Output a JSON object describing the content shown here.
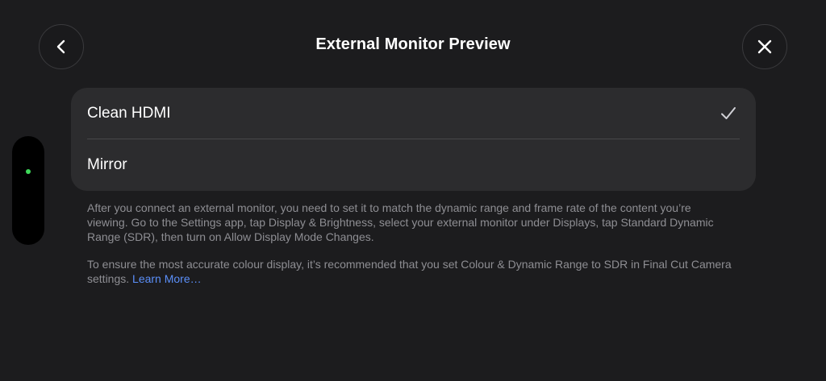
{
  "header": {
    "title": "External Monitor Preview",
    "back_icon": "chevron-left-icon",
    "close_icon": "close-icon"
  },
  "side_indicator": {
    "dot_color": "#3fd95a"
  },
  "options": [
    {
      "label": "Clean HDMI",
      "selected": true
    },
    {
      "label": "Mirror",
      "selected": false
    }
  ],
  "info": {
    "paragraph1": "After you connect an external monitor, you need to set it to match the dynamic range and frame rate of the content you’re viewing. Go to the Settings app, tap Display & Brightness, select your external monitor under Displays, tap Standard Dynamic Range (SDR), then turn on Allow Display Mode Changes.",
    "paragraph2_text": "To ensure the most accurate colour display, it’s recommended that you set Colour & Dynamic Range to SDR in Final Cut Camera settings.",
    "paragraph2_link": "Learn More…"
  },
  "colors": {
    "background": "#1c1c1e",
    "card": "#2c2c2e",
    "link": "#5b8ff9",
    "secondary_text": "#8e8e93"
  }
}
